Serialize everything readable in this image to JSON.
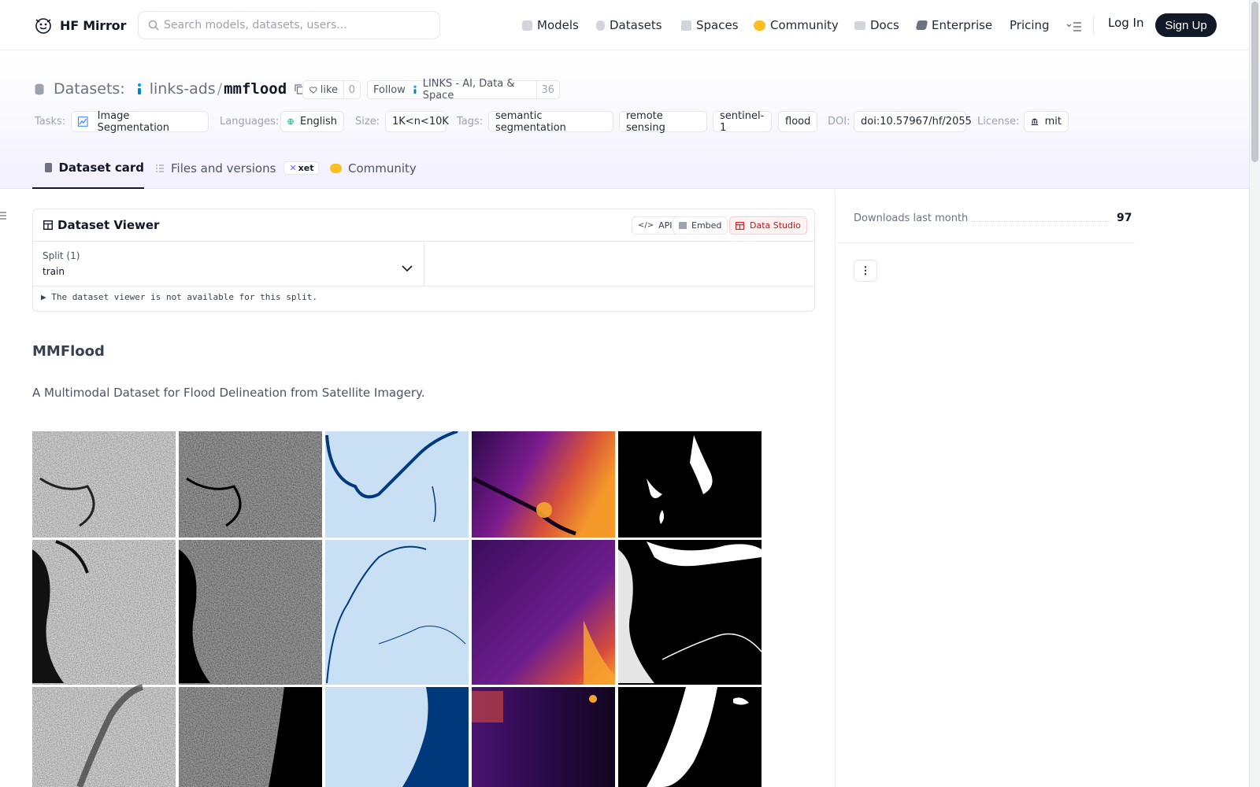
{
  "nav": {
    "brand": "HF Mirror",
    "search_placeholder": "Search models, datasets, users...",
    "items": [
      {
        "label": "Models",
        "icon": "models-icon",
        "color": "#9ca3af"
      },
      {
        "label": "Datasets",
        "icon": "datasets-icon",
        "color": "#9ca3af"
      },
      {
        "label": "Spaces",
        "icon": "spaces-icon",
        "color": "#9ca3af"
      },
      {
        "label": "Community",
        "icon": "community-icon",
        "color": "#fbbf24"
      },
      {
        "label": "Docs",
        "icon": "docs-icon",
        "color": "#9ca3af"
      },
      {
        "label": "Enterprise",
        "icon": "enterprise-icon",
        "color": "#6b7280"
      },
      {
        "label": "Pricing",
        "icon": null,
        "color": null
      }
    ],
    "login": "Log In",
    "signup": "Sign Up"
  },
  "dataset": {
    "section_label": "Datasets:",
    "org": "links-ads",
    "slash": "/",
    "name": "mmflood",
    "like_label": "like",
    "like_count": "0",
    "follow_label": "Follow",
    "follow_org": "LINKS - AI, Data & Space",
    "follower_count": "36"
  },
  "meta": {
    "tasks_label": "Tasks:",
    "task": "Image Segmentation",
    "languages_label": "Languages:",
    "language": "English",
    "size_label": "Size:",
    "size": "1K<n<10K",
    "tags_label": "Tags:",
    "tags": [
      "semantic segmentation",
      "remote sensing",
      "sentinel-1",
      "flood"
    ],
    "doi_label": "DOI:",
    "doi": "doi:10.57967/hf/2055",
    "license_label": "License:",
    "license": "mit"
  },
  "tabs": [
    {
      "label": "Dataset card",
      "active": true
    },
    {
      "label": "Files and versions",
      "badge": "xet",
      "active": false
    },
    {
      "label": "Community",
      "active": false
    }
  ],
  "viewer": {
    "title": "Dataset Viewer",
    "api_label": "API",
    "embed_label": "Embed",
    "studio_label": "Data Studio",
    "split_label": "Split (1)",
    "split_value": "train",
    "note": "▶ The dataset viewer is not available for this split."
  },
  "card": {
    "title": "MMFlood",
    "description": "A Multimodal Dataset for Flood Delineation from Satellite Imagery."
  },
  "figure": {
    "columns": [
      "sar-vv",
      "sar-vh",
      "hydrography",
      "dem",
      "flood-mask"
    ],
    "colors": {
      "hydro_water": "#003a7d",
      "hydro_land": "#c8dff4",
      "dem_low": "#1a0633",
      "dem_mid": "#8b1f93",
      "dem_high": "#f6a02a",
      "mask_on": "#ffffff",
      "mask_off": "#000000"
    }
  },
  "sidebar": {
    "downloads_label": "Downloads last month",
    "downloads_value": "97",
    "more_label": "⋮"
  }
}
